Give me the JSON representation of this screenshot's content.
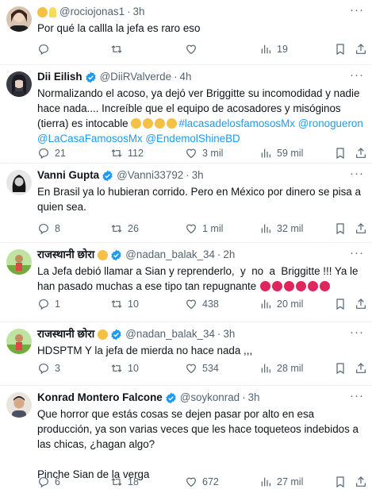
{
  "tweets": [
    {
      "handle": "@rociojonas1",
      "time": "3h",
      "text": "Por qué la callla la jefa es raro eso",
      "replies": "",
      "retweets": "",
      "likes": "",
      "views": "19",
      "avatar_color": "#6b4c3b"
    },
    {
      "name": "Dii Eilish",
      "handle": "@DiiRValverde",
      "time": "4h",
      "text_part1": "Normalizando el acoso, ya dejó ver Briggitte su incomodidad y nadie hace nada.... Increíble que el equipo de acosadores y misóginos (tierra) es intocable ",
      "hashtag": "#lacasadelosfamososMx",
      "mention1": "@ronogueron",
      "mention2": "@LaCasaFamososMx",
      "mention3": "@EndemolShineBD",
      "replies": "21",
      "retweets": "112",
      "likes": "3 mil",
      "views": "59 mil",
      "avatar_color": "#2f2f3a"
    },
    {
      "name": "Vanni Gupta",
      "handle": "@Vanni33792",
      "time": "3h",
      "text": "En Brasil ya lo hubieran corrido. Pero en México por dinero se pisa a quien sea.",
      "replies": "8",
      "retweets": "26",
      "likes": "1 mil",
      "views": "32 mil",
      "avatar_color": "#1a1a1a"
    },
    {
      "name": "राजस्थानी छोरा",
      "handle": "@nadan_balak_34",
      "time": "2h",
      "text": "La Jefa debió llamar a Sian y reprenderlo,  y  no  a  Briggitte !!! Ya le han pasado muchas a ese tipo tan repugnante",
      "replies": "1",
      "retweets": "10",
      "likes": "438",
      "views": "20 mil",
      "avatar_color": "#7fbf4a"
    },
    {
      "name": "राजस्थानी छोरा",
      "handle": "@nadan_balak_34",
      "time": "3h",
      "text": "HDSPTM Y la jefa de mierda no hace nada ,,,",
      "replies": "3",
      "retweets": "10",
      "likes": "534",
      "views": "28 mil",
      "avatar_color": "#7fbf4a"
    },
    {
      "name": "Konrad Montero Falcone",
      "handle": "@soykonrad",
      "time": "3h",
      "text": "Que horror que estás cosas se dejen pasar por alto en esa producción, ya son varias veces que les hace toqueteos indebidos a las chicas, ¿hagan algo?\n\nPinche Sian de la verga",
      "replies": "6",
      "retweets": "18",
      "likes": "672",
      "views": "27 mil",
      "avatar_color": "#c9a58a"
    }
  ],
  "colors": {
    "text": "#0f1419",
    "secondary": "#536471",
    "link": "#1d9bf0",
    "verified": "#1d9bf0",
    "divider": "#eff3f4"
  },
  "icons": {
    "reply": "reply-icon",
    "retweet": "retweet-icon",
    "like": "like-icon",
    "views": "views-icon",
    "bookmark": "bookmark-icon",
    "share": "share-icon",
    "verified": "verified-badge-icon",
    "more": "more-icon"
  }
}
